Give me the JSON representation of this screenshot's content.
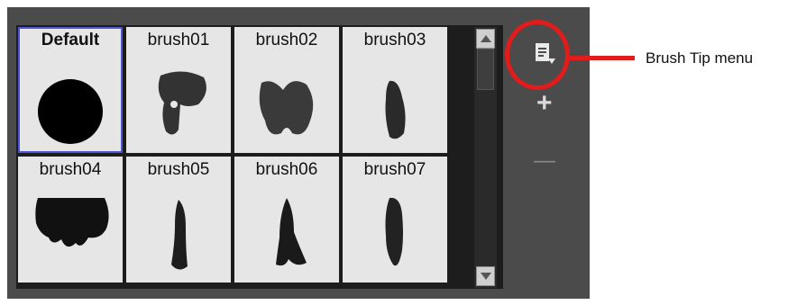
{
  "brushes": [
    {
      "label": "Default"
    },
    {
      "label": "brush01"
    },
    {
      "label": "brush02"
    },
    {
      "label": "brush03"
    },
    {
      "label": "brush04"
    },
    {
      "label": "brush05"
    },
    {
      "label": "brush06"
    },
    {
      "label": "brush07"
    }
  ],
  "selected_brush": "Default",
  "side_buttons": {
    "menu_icon": "brush-tip-menu-icon",
    "add_label": "+",
    "remove_label": "—"
  },
  "callout": {
    "text": "Brush Tip menu",
    "color": "#e21b1b"
  },
  "colors": {
    "panel": "#4b4b4b",
    "tile": "#e6e6e6",
    "selection": "#4b55d6"
  }
}
